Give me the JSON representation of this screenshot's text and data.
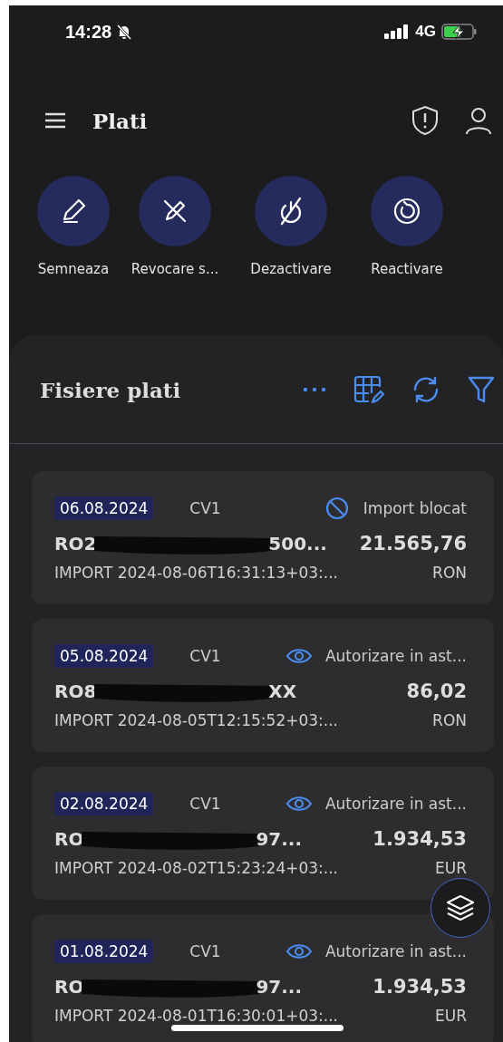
{
  "status_bar": {
    "time": "14:28",
    "network": "4G"
  },
  "header": {
    "title": "Plati"
  },
  "actions": [
    {
      "label": "Semneaza",
      "kind": "sign"
    },
    {
      "label": "Revocare s...",
      "kind": "revoke"
    },
    {
      "label": "Dezactivare",
      "kind": "disable"
    },
    {
      "label": "Reactivare",
      "kind": "reactivate"
    }
  ],
  "panel": {
    "title": "Fisiere plati"
  },
  "files": [
    {
      "date": "06.08.2024",
      "code": "CV1",
      "status": "Import blocat",
      "kind": "blocked",
      "account_start": "RO2",
      "account_end": "500...",
      "amount": "21.565,76",
      "description": "IMPORT 2024-08-06T16:31:13+03:...",
      "currency": "RON"
    },
    {
      "date": "05.08.2024",
      "code": "CV1",
      "status": "Autorizare in ast...",
      "kind": "pending",
      "account_start": "RO8",
      "account_end": "XX",
      "amount": "86,02",
      "description": "IMPORT 2024-08-05T12:15:52+03:...",
      "currency": "RON"
    },
    {
      "date": "02.08.2024",
      "code": "CV1",
      "status": "Autorizare in ast...",
      "kind": "pending",
      "account_start": "RO",
      "account_end": "97...",
      "amount": "1.934,53",
      "description": "IMPORT 2024-08-02T15:23:24+03:...",
      "currency": "EUR"
    },
    {
      "date": "01.08.2024",
      "code": "CV1",
      "status": "Autorizare in ast...",
      "kind": "pending",
      "account_start": "RO",
      "account_end": "97...",
      "amount": "1.934,53",
      "description": "IMPORT 2024-08-01T16:30:01+03:...",
      "currency": "EUR"
    }
  ]
}
